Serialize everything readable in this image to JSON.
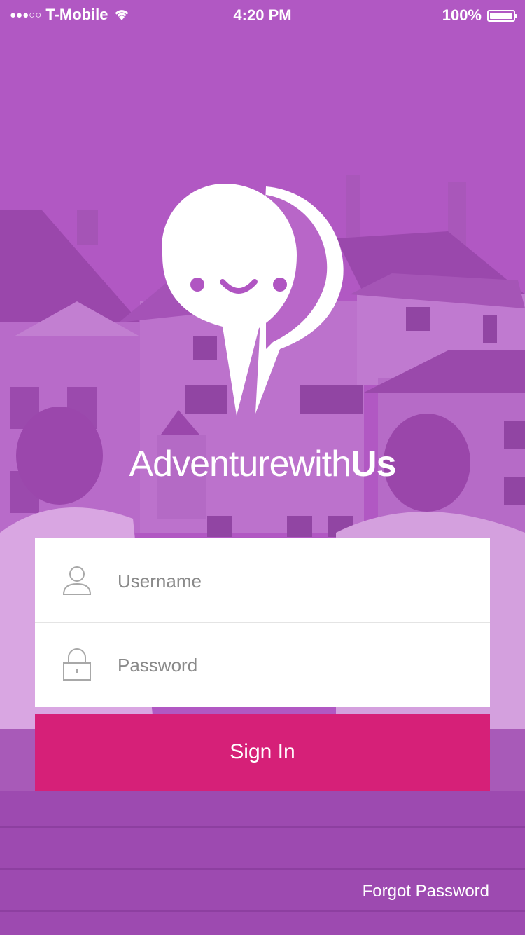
{
  "status_bar": {
    "signal_dots": "●●●○○",
    "carrier": "T-Mobile",
    "time": "4:20 PM",
    "battery": "100%",
    "icons": [
      "wifi-icon",
      "battery-icon"
    ]
  },
  "brand": {
    "name_light": "Adventurewith",
    "name_bold": "Us",
    "logo_icon": "smiling-map-pin-icon"
  },
  "form": {
    "username": {
      "value": "",
      "placeholder": "Username",
      "icon": "user-icon"
    },
    "password": {
      "value": "",
      "placeholder": "Password",
      "icon": "lock-icon"
    },
    "sign_in_label": "Sign In"
  },
  "forgot_password_label": "Forgot Password",
  "colors": {
    "background": "#b055c2",
    "primary_button": "#d62078",
    "logo_face": "#b055c2",
    "text_light": "#ffffff"
  }
}
